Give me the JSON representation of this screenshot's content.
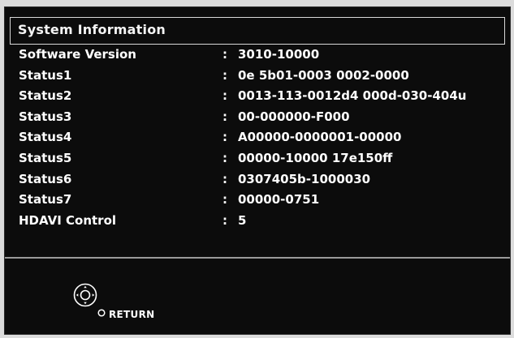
{
  "window": {
    "title": "System Information"
  },
  "info_rows": [
    {
      "label": "Software Version",
      "value": "3010-10000"
    },
    {
      "label": "Status1",
      "value": "0e 5b01-0003 0002-0000"
    },
    {
      "label": "Status2",
      "value": "0013-113-0012d4 000d-030-404u"
    },
    {
      "label": "Status3",
      "value": "00-000000-F000"
    },
    {
      "label": "Status4",
      "value": "A00000-0000001-00000"
    },
    {
      "label": "Status5",
      "value": "00000-10000 17e150ff"
    },
    {
      "label": "Status6",
      "value": "0307405b-1000030"
    },
    {
      "label": "Status7",
      "value": "00000-0751"
    },
    {
      "label": "HDAVI Control",
      "value": "5"
    }
  ],
  "separator": ":",
  "footer": {
    "return_label": "RETURN",
    "dpad_icon": "dpad-ok-icon",
    "return_icon": "return-button-icon"
  },
  "colors": {
    "background": "#0c0c0c",
    "text": "#ffffff",
    "border": "#d8d8d8"
  }
}
